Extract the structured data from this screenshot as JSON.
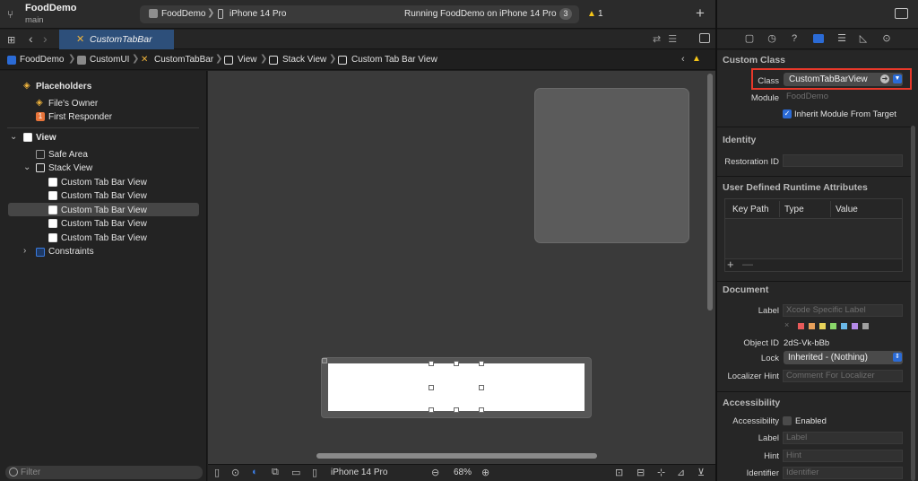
{
  "titlebar": {
    "project": "FoodDemo",
    "branch": "main",
    "scheme": "FoodDemo",
    "device": "iPhone 14 Pro",
    "status": "Running FoodDemo on iPhone 14 Pro",
    "status_count": "3",
    "warning_count": "1",
    "add_label": "+"
  },
  "tabbar": {
    "active_tab": "CustomTabBar"
  },
  "breadcrumb": [
    "FoodDemo",
    "CustomUI",
    "CustomTabBar",
    "View",
    "Stack View",
    "Custom Tab Bar View"
  ],
  "outline": {
    "placeholders": "Placeholders",
    "files_owner": "File's Owner",
    "first_responder": "First Responder",
    "first_responder_badge": "1",
    "view": "View",
    "safe_area": "Safe Area",
    "stack_view": "Stack View",
    "items": [
      "Custom Tab Bar View",
      "Custom Tab Bar View",
      "Custom Tab Bar View",
      "Custom Tab Bar View",
      "Custom Tab Bar View"
    ],
    "constraints": "Constraints",
    "filter_placeholder": "Filter"
  },
  "canvas_bar": {
    "device": "iPhone 14 Pro",
    "zoom": "68%"
  },
  "inspector": {
    "custom_class": {
      "title": "Custom Class",
      "class_label": "Class",
      "class_value": "CustomTabBarView",
      "module_label": "Module",
      "module_placeholder": "FoodDemo",
      "inherit_label": "Inherit Module From Target",
      "inherit_checked": true
    },
    "identity": {
      "title": "Identity",
      "restoration_label": "Restoration ID",
      "restoration_value": ""
    },
    "runtime_attrs": {
      "title": "User Defined Runtime Attributes",
      "columns": [
        "Key Path",
        "Type",
        "Value"
      ],
      "add_label": "+",
      "remove_label": "—"
    },
    "document": {
      "title": "Document",
      "label_label": "Label",
      "label_placeholder": "Xcode Specific Label",
      "clear_label": "×",
      "swatches": [
        "#e85a5a",
        "#e8a05a",
        "#e8d45a",
        "#8ad86a",
        "#6ab8e8",
        "#b48ae8",
        "#a0a0a0"
      ],
      "object_id_label": "Object ID",
      "object_id_value": "2dS-Vk-bBb",
      "lock_label": "Lock",
      "lock_value": "Inherited - (Nothing)",
      "hint_label": "Localizer Hint",
      "hint_placeholder": "Comment For Localizer"
    },
    "accessibility": {
      "title": "Accessibility",
      "acc_label": "Accessibility",
      "enabled_label": "Enabled",
      "label_label": "Label",
      "label_placeholder": "Label",
      "hint_label": "Hint",
      "hint_placeholder": "Hint",
      "identifier_label": "Identifier",
      "identifier_placeholder": "Identifier"
    }
  },
  "colors": {
    "accent": "#2b6bd6",
    "highlight": "#e8382a",
    "warning": "#f5c518"
  }
}
